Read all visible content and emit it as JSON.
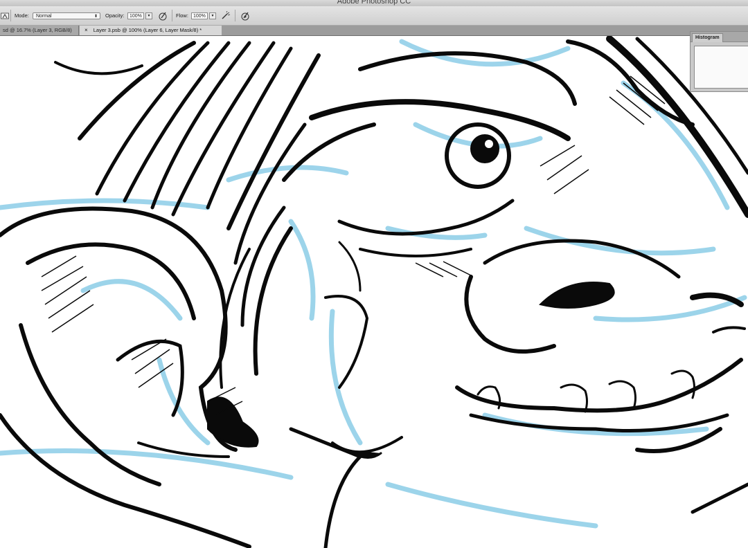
{
  "window": {
    "title": "Adobe Photoshop CC"
  },
  "options_bar": {
    "mode_label": "Mode:",
    "mode_value": "Normal",
    "opacity_label": "Opacity:",
    "opacity_value": "100%",
    "flow_label": "Flow:",
    "flow_value": "100%",
    "icons": [
      "brush-tool-icon",
      "pressure-opacity-icon",
      "airbrush-icon",
      "pressure-size-icon"
    ]
  },
  "tabs": [
    {
      "label": "sd @ 16.7% (Layer 3, RGB/8)",
      "active": false
    },
    {
      "close": "×",
      "label": "Layer 3.psb @ 100% (Layer 6, Layer Mask/8) *",
      "active": true
    }
  ],
  "panels": {
    "histogram": {
      "tab_label": "Histogram"
    }
  },
  "colors": {
    "ink": "#0a0a0a",
    "sketch_blue": "#7cc6e4",
    "chrome_bg": "#d6d6d6"
  }
}
